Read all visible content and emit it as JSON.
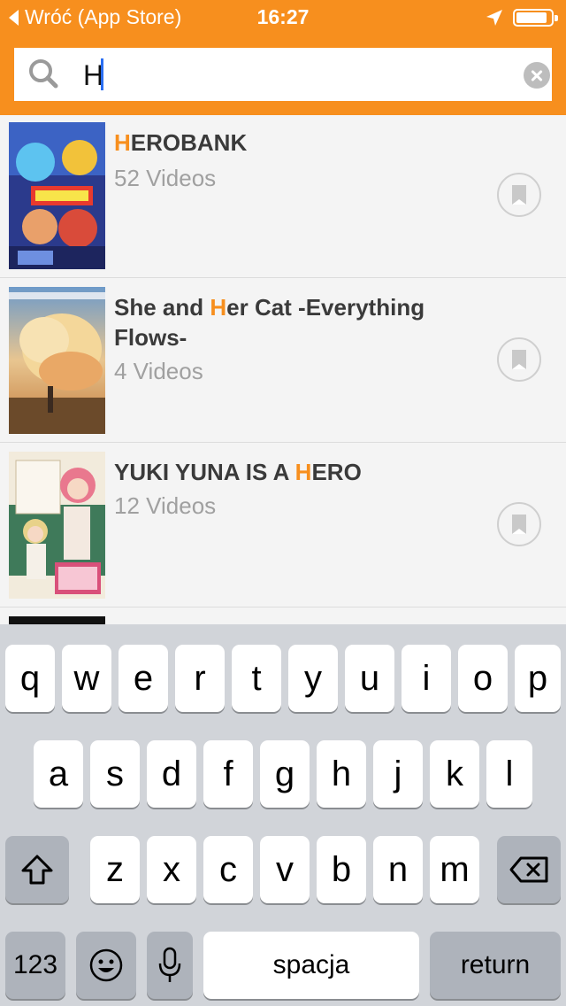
{
  "status_bar": {
    "back_label": "Wróć (App Store)",
    "time": "16:27"
  },
  "search": {
    "value": "H"
  },
  "results": [
    {
      "title_prefix": "",
      "title_highlight": "H",
      "title_suffix": "EROBANK",
      "count": "52 Videos"
    },
    {
      "title_prefix": "She and ",
      "title_highlight": "H",
      "title_suffix": "er Cat -Everything Flows-",
      "count": "4 Videos"
    },
    {
      "title_prefix": "YUKI YUNA IS A ",
      "title_highlight": "H",
      "title_suffix": "ERO",
      "count": "12 Videos"
    }
  ],
  "keyboard": {
    "row1": [
      "q",
      "w",
      "e",
      "r",
      "t",
      "y",
      "u",
      "i",
      "o",
      "p"
    ],
    "row2": [
      "a",
      "s",
      "d",
      "f",
      "g",
      "h",
      "j",
      "k",
      "l"
    ],
    "row3": [
      "z",
      "x",
      "c",
      "v",
      "b",
      "n",
      "m"
    ],
    "numbers_label": "123",
    "space_label": "spacja",
    "return_label": "return"
  },
  "colors": {
    "accent": "#f78f1e",
    "results_background": "#f4f4f4",
    "keyboard_background": "#d1d4d9"
  }
}
